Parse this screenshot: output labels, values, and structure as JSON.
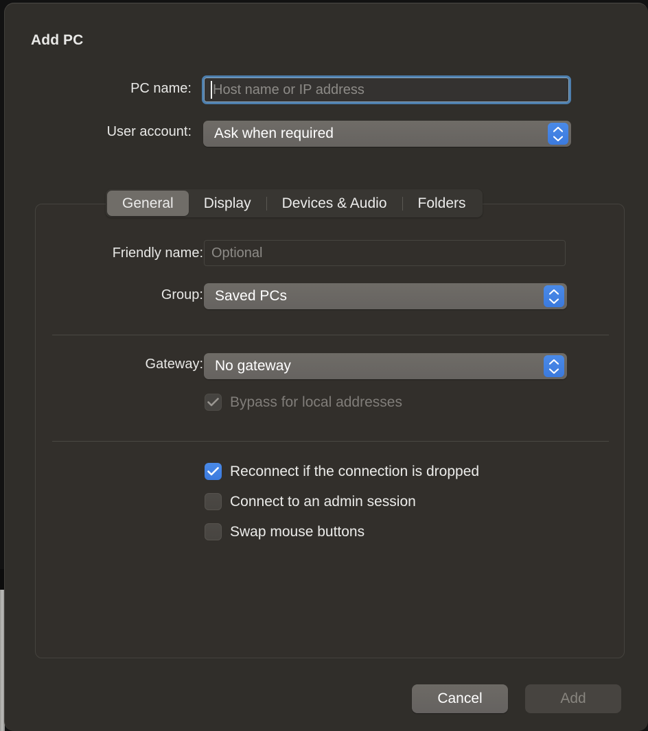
{
  "dialog": {
    "title": "Add PC"
  },
  "top_fields": {
    "pc_name": {
      "label": "PC name:",
      "placeholder": "Host name or IP address",
      "value": ""
    },
    "user_account": {
      "label": "User account:",
      "selected": "Ask when required"
    }
  },
  "tabs": [
    {
      "label": "General",
      "selected": true
    },
    {
      "label": "Display",
      "selected": false
    },
    {
      "label": "Devices & Audio",
      "selected": false
    },
    {
      "label": "Folders",
      "selected": false
    }
  ],
  "general": {
    "friendly_name": {
      "label": "Friendly name:",
      "placeholder": "Optional",
      "value": ""
    },
    "group": {
      "label": "Group:",
      "selected": "Saved PCs"
    },
    "gateway": {
      "label": "Gateway:",
      "selected": "No gateway"
    },
    "bypass": {
      "label": "Bypass for local addresses",
      "checked": true,
      "disabled": true
    },
    "options": [
      {
        "label": "Reconnect if the connection is dropped",
        "checked": true
      },
      {
        "label": "Connect to an admin session",
        "checked": false
      },
      {
        "label": "Swap mouse buttons",
        "checked": false
      }
    ]
  },
  "footer": {
    "cancel": "Cancel",
    "add": "Add"
  },
  "colors": {
    "accent_blue": "#3b7ade",
    "focus_ring": "#4d7fae",
    "sheet_bg": "#302e2a",
    "popup_bg": "#6f6c67"
  }
}
